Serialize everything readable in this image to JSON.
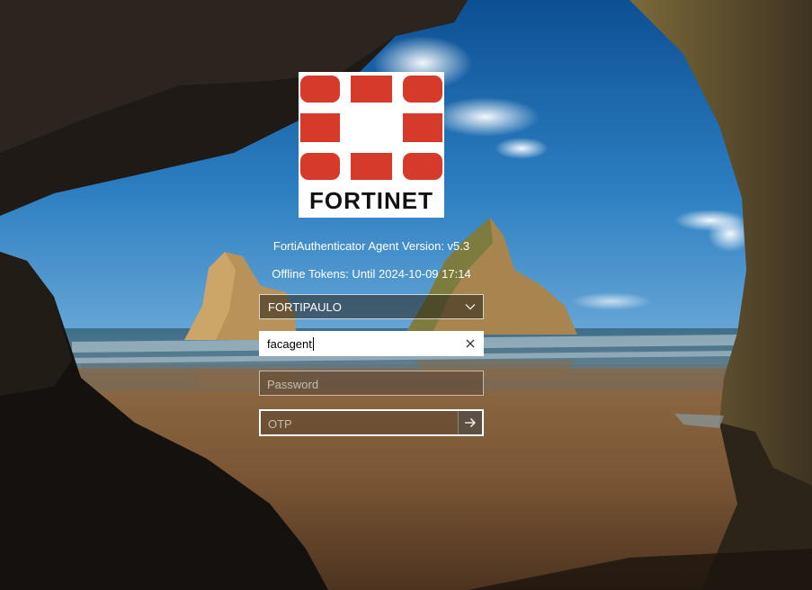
{
  "logo": {
    "name": "fortinet-logo",
    "brand_text": "FORTINET",
    "brand_color": "#D63A2B"
  },
  "agent_info": {
    "version_text": "FortiAuthenticator Agent Version: v5.3",
    "offline_text": "Offline Tokens: Until 2024-10-09 17:14"
  },
  "login": {
    "domain": {
      "selected": "FORTIPAULO",
      "icon": "chevron-down-icon"
    },
    "username": {
      "value": "facagent",
      "clear_icon": "close-icon"
    },
    "password": {
      "placeholder": "Password"
    },
    "otp": {
      "placeholder": "OTP",
      "submit_icon": "arrow-right-icon"
    }
  }
}
